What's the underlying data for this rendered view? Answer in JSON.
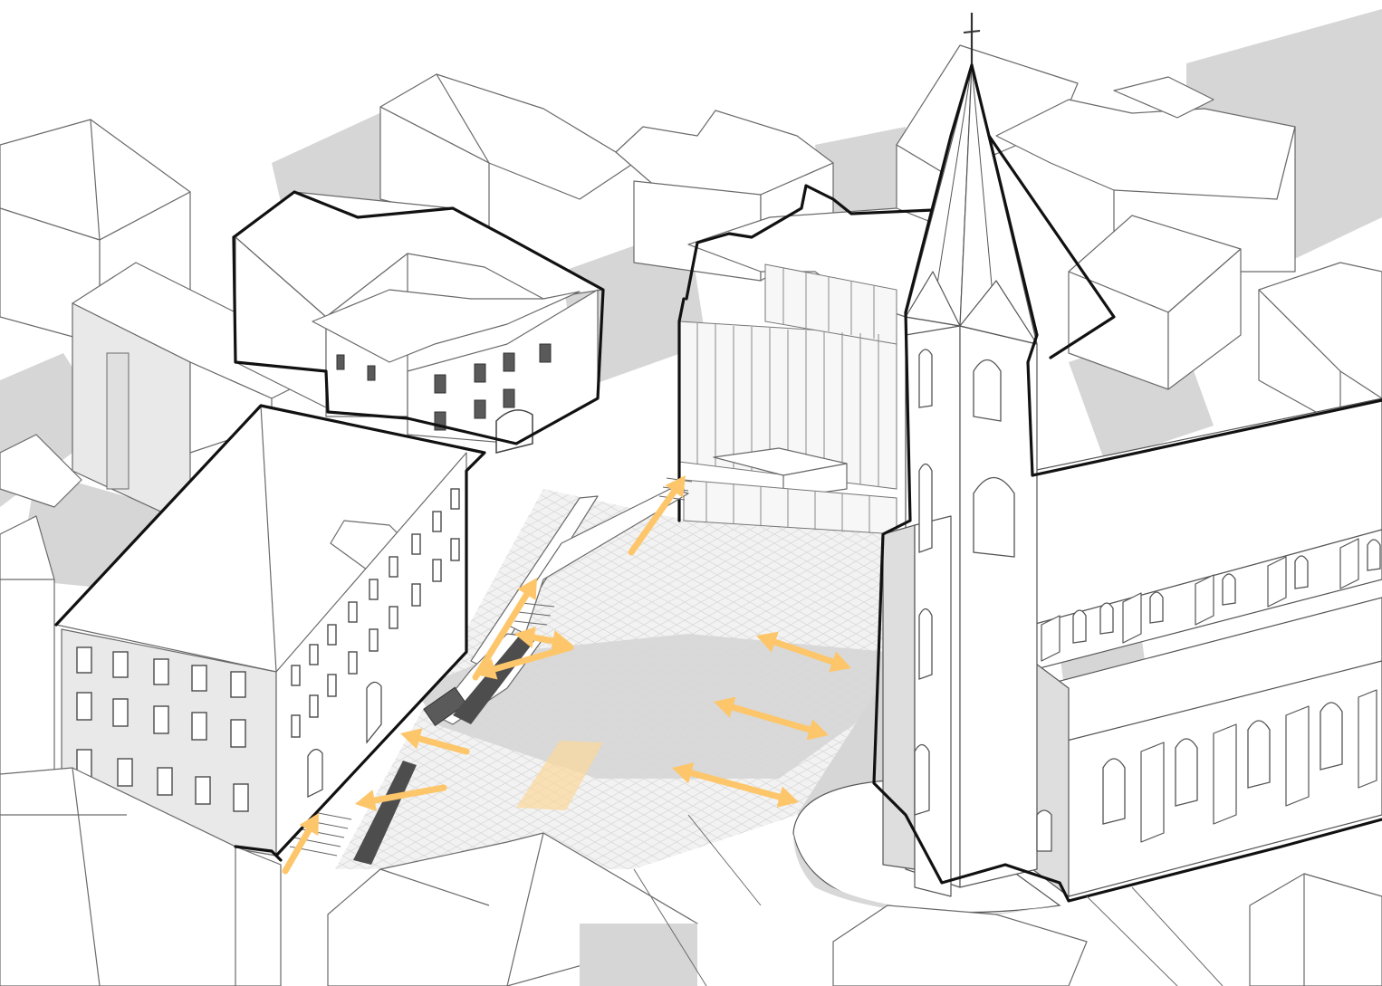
{
  "diagram": {
    "kind": "isometric-urban-square",
    "colors": {
      "background": "#ffffff",
      "building_fill": "#ffffff",
      "shadow": "#d6d6d6",
      "outline_emphasis": "#111111",
      "paving": "#f2f2f2",
      "movement_arrow": "#fdc66a",
      "highlight_zone": "#fbd79a"
    },
    "icons": {
      "movement": "double-headed-arrow-icon",
      "entry": "single-arrow-icon",
      "steeple_cross": "cross-icon"
    },
    "arrows": [
      {
        "id": "stair-entry-southwest",
        "type": "single"
      },
      {
        "id": "stair-entry-north",
        "type": "single"
      },
      {
        "id": "ramp-entry-west",
        "type": "single"
      },
      {
        "id": "bench-west-upper",
        "type": "single"
      },
      {
        "id": "bench-west-lower",
        "type": "single"
      },
      {
        "id": "bench-west-middle",
        "type": "single"
      },
      {
        "id": "church-link-upper",
        "type": "double"
      },
      {
        "id": "church-link-middle",
        "type": "double"
      },
      {
        "id": "church-link-lower",
        "type": "double"
      },
      {
        "id": "stair-link-west",
        "type": "double"
      }
    ]
  }
}
